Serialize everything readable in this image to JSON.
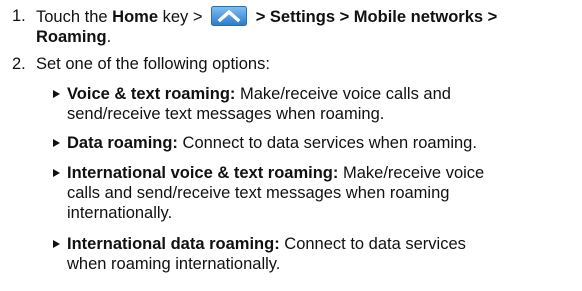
{
  "steps": [
    {
      "number": "1.",
      "touch": "Touch the",
      "home_key": "Home",
      "key_word": "key >",
      "path_suffix": "> Settings > Mobile networks >",
      "path_last": "Roaming",
      "period": "."
    },
    {
      "number": "2.",
      "text": "Set one of the following options:"
    }
  ],
  "options": [
    {
      "title": "Voice & text roaming:",
      "line1": "Make/receive voice calls and",
      "line2": "send/receive text messages when roaming.",
      "line3": ""
    },
    {
      "title": "Data roaming:",
      "line1": "Connect to data services when roaming.",
      "line2": "",
      "line3": ""
    },
    {
      "title": "International voice & text roaming:",
      "line1": "Make/receive voice",
      "line2": "calls and send/receive text messages when roaming",
      "line3": "internationally."
    },
    {
      "title": "International data roaming:",
      "line1": "Connect to data services",
      "line2": "when roaming internationally.",
      "line3": ""
    }
  ],
  "icons": {
    "home_icon": "up-chevron-icon",
    "bullet_icon": "triangle-bullet-icon",
    "accent": "#3b8ed8"
  }
}
